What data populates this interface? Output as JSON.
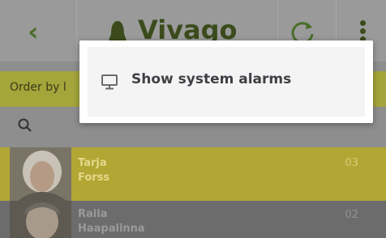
{
  "topbar": {
    "logo_text": "Vivago",
    "icons": [
      "chevron-left-icon",
      "bell-icon",
      "refresh-icon",
      "more-vertical-icon"
    ]
  },
  "orderbar": {
    "label": "Order by l"
  },
  "search": {
    "icon": "search-icon"
  },
  "residents": [
    {
      "first": "Tarja",
      "last": "Forss",
      "room": "03",
      "row_color": "#b2a634"
    },
    {
      "first": "Raila",
      "last": "Haapalinna",
      "room": "02",
      "row_color": "#6c6c6c"
    }
  ],
  "popup": {
    "item_label": "Show system alarms",
    "icon": "monitor-icon"
  },
  "colors": {
    "accent": "#b9c425",
    "accent_dimmed": "#a4a53a",
    "popup_bg": "#ffffff"
  }
}
